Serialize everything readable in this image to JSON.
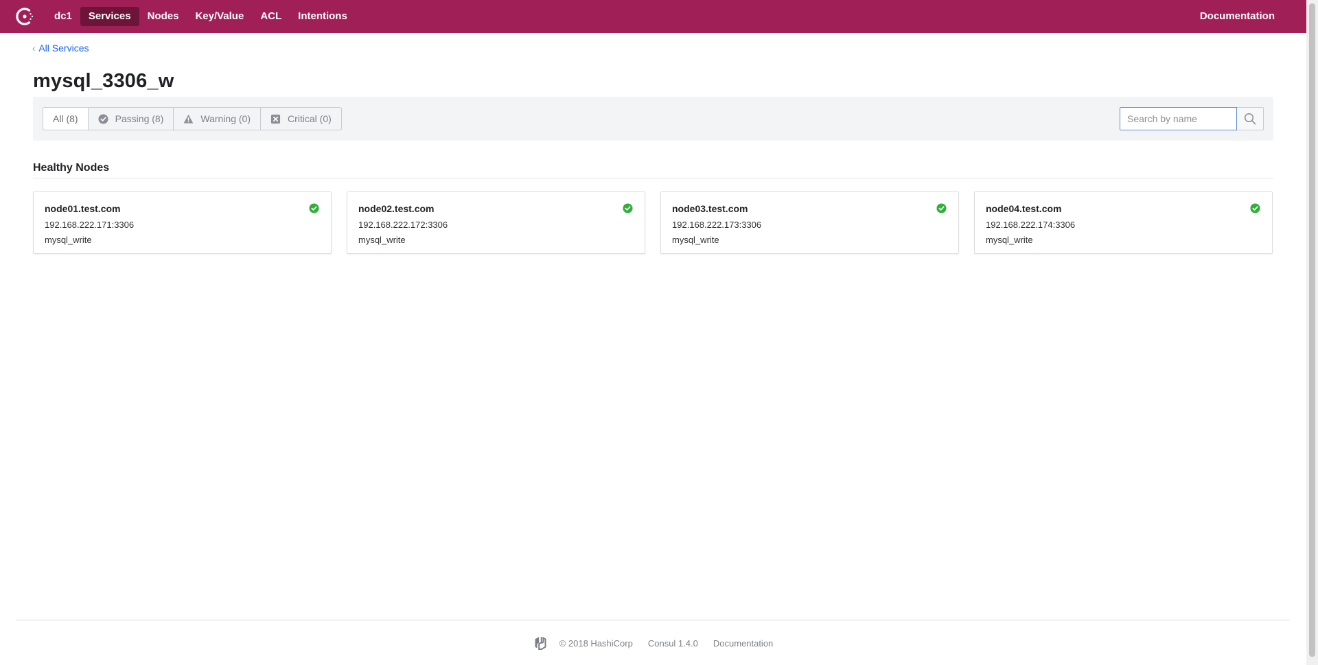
{
  "nav": {
    "datacenter": "dc1",
    "items": [
      {
        "label": "Services",
        "active": true
      },
      {
        "label": "Nodes",
        "active": false
      },
      {
        "label": "Key/Value",
        "active": false
      },
      {
        "label": "ACL",
        "active": false
      },
      {
        "label": "Intentions",
        "active": false
      }
    ],
    "documentation": "Documentation"
  },
  "breadcrumb": {
    "label": "All Services"
  },
  "page": {
    "title": "mysql_3306_w"
  },
  "filters": [
    {
      "label": "All (8)",
      "icon": "none"
    },
    {
      "label": "Passing (8)",
      "icon": "check-circle-icon"
    },
    {
      "label": "Warning (0)",
      "icon": "warning-triangle-icon"
    },
    {
      "label": "Critical (0)",
      "icon": "critical-x-icon"
    }
  ],
  "search": {
    "placeholder": "Search by name",
    "value": ""
  },
  "section": {
    "heading": "Healthy Nodes"
  },
  "nodes": [
    {
      "name": "node01.test.com",
      "address": "192.168.222.171:3306",
      "tag": "mysql_write",
      "status": "passing"
    },
    {
      "name": "node02.test.com",
      "address": "192.168.222.172:3306",
      "tag": "mysql_write",
      "status": "passing"
    },
    {
      "name": "node03.test.com",
      "address": "192.168.222.173:3306",
      "tag": "mysql_write",
      "status": "passing"
    },
    {
      "name": "node04.test.com",
      "address": "192.168.222.174:3306",
      "tag": "mysql_write",
      "status": "passing"
    }
  ],
  "footer": {
    "copyright": "© 2018 HashiCorp",
    "version": "Consul 1.4.0",
    "documentation": "Documentation"
  },
  "colors": {
    "brand": "#a11f57",
    "brand_active": "#6c1539",
    "link": "#1563ff",
    "passing": "#2eb039"
  }
}
